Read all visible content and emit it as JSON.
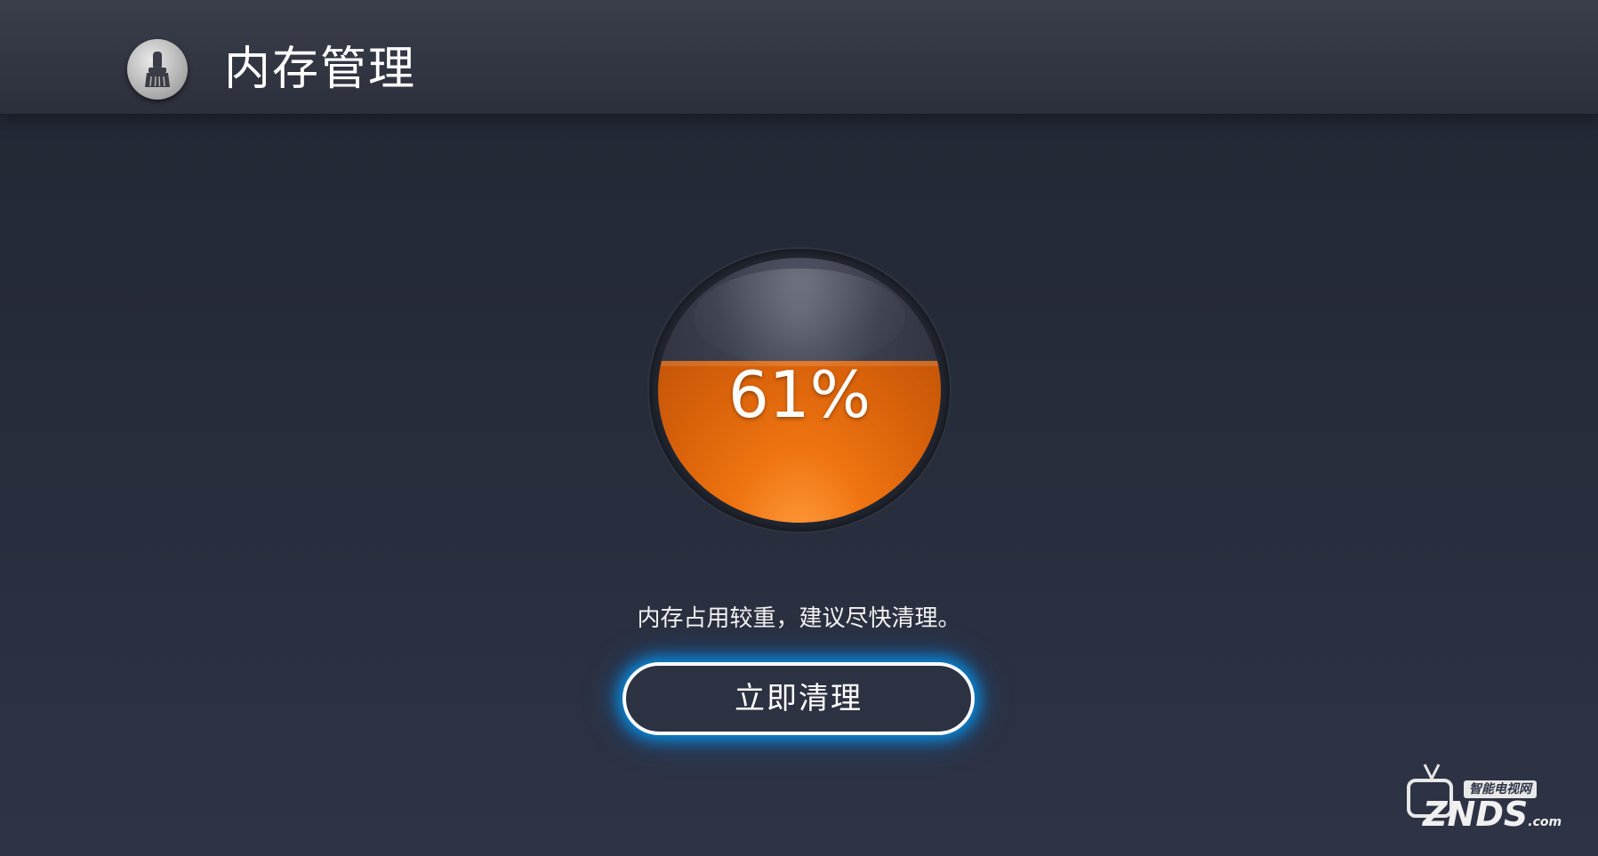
{
  "header": {
    "title": "内存管理",
    "icon": "broom-icon"
  },
  "gauge": {
    "percent_label": "61%",
    "usage_fraction": 0.61,
    "fill_color": "#e8700f"
  },
  "hint": {
    "text": "内存占用较重，建议尽快清理。"
  },
  "actions": {
    "clean_now_label": "立即清理",
    "focus_glow_color": "#12a4ff"
  },
  "watermark": {
    "cn_text": "智能电视网",
    "brand": "ZNDS",
    "suffix": ".com"
  }
}
